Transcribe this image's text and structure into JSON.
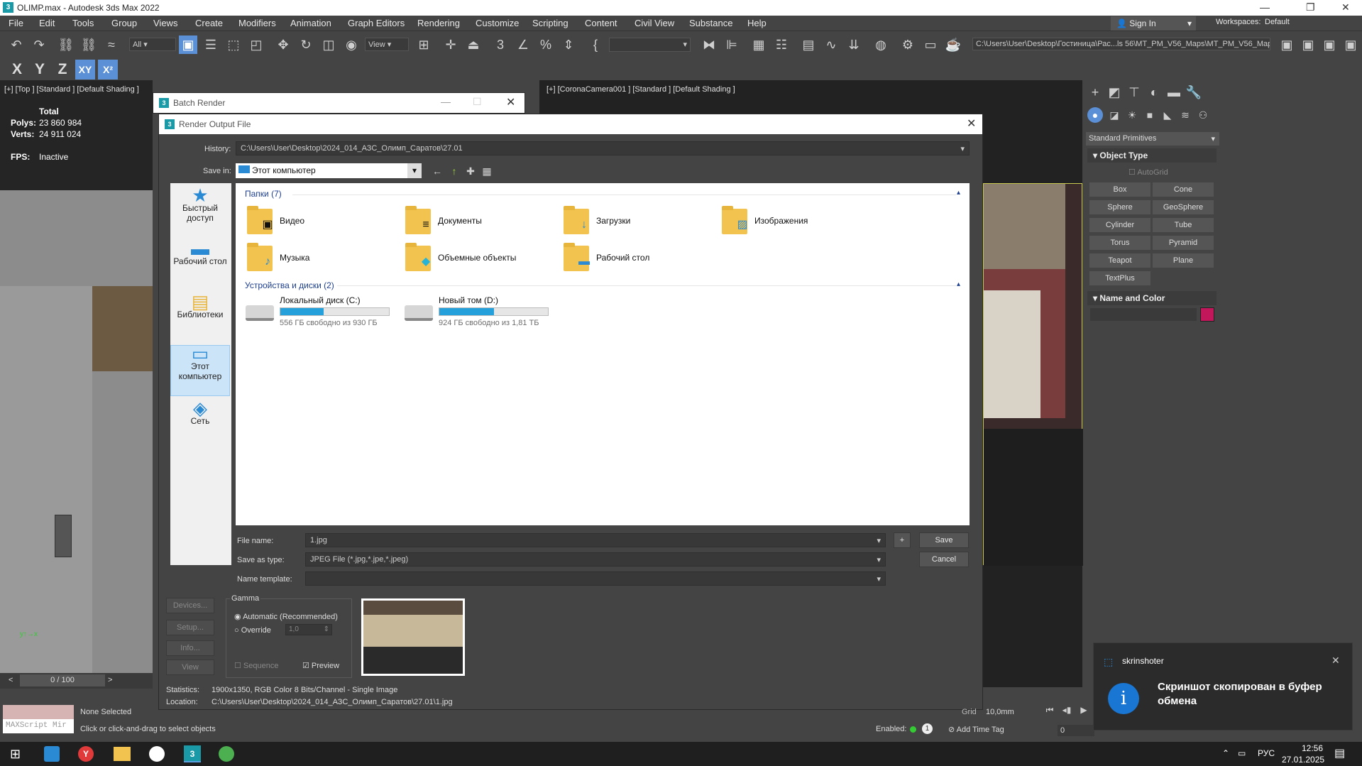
{
  "window": {
    "title": "OLIMP.max - Autodesk 3ds Max 2022",
    "app_icon": "3"
  },
  "menu": [
    "File",
    "Edit",
    "Tools",
    "Group",
    "Views",
    "Create",
    "Modifiers",
    "Animation",
    "Graph Editors",
    "Rendering",
    "Customize",
    "Scripting",
    "Content",
    "Civil View",
    "Substance",
    "Help"
  ],
  "signin": {
    "label": "Sign In",
    "workspaces_label": "Workspaces:",
    "workspace_value": "Default"
  },
  "toolbar": {
    "selection_filter": "All",
    "ref_coord": "View",
    "project_path": "C:\\Users\\User\\Desktop\\Гостиница\\Рас...ls 56\\MT_PM_V56_Maps\\MT_PM_V56_Maps"
  },
  "axis_buttons": [
    "X",
    "Y",
    "Z",
    "XY",
    "X²"
  ],
  "viewport_left": {
    "label": "[+] [Top ] [Standard ] [Default Shading ]"
  },
  "viewport_right": {
    "label": "[+] [CoronaCamera001 ] [Standard ] [Default Shading ]"
  },
  "stats": {
    "header": "Total",
    "polys_label": "Polys:",
    "polys_value": "23 860 984",
    "verts_label": "Verts:",
    "verts_value": "24 911 024",
    "fps_label": "FPS:",
    "fps_value": "Inactive"
  },
  "command_panel": {
    "dropdown": "Standard Primitives",
    "object_type": "Object Type",
    "autogrid": "AutoGrid",
    "buttons": [
      "Box",
      "Cone",
      "Sphere",
      "GeoSphere",
      "Cylinder",
      "Tube",
      "Torus",
      "Pyramid",
      "Teapot",
      "Plane",
      "TextPlus"
    ],
    "name_and_color": "Name and Color",
    "color": "#c2185b"
  },
  "batch_render": {
    "title": "Batch Render"
  },
  "render_output": {
    "title": "Render Output File",
    "history_label": "History:",
    "history_value": "C:\\Users\\User\\Desktop\\2024_014_АЗС_Олимп_Саратов\\27.01",
    "save_in_label": "Save in:",
    "save_in_value": "Этот компьютер",
    "nav": [
      {
        "label": "Быстрый доступ",
        "icon": "star-icon",
        "glyph": "★"
      },
      {
        "label": "Рабочий стол",
        "icon": "desktop-icon",
        "glyph": "▬"
      },
      {
        "label": "Библиотеки",
        "icon": "libraries-icon",
        "glyph": "▤"
      },
      {
        "label": "Этот компьютер",
        "icon": "computer-icon",
        "glyph": "▭"
      },
      {
        "label": "Сеть",
        "icon": "network-icon",
        "glyph": "◈"
      }
    ],
    "folders_header": "Папки (7)",
    "folders": [
      {
        "name": "Видео",
        "icon": "video-folder-icon",
        "glyph": "▣"
      },
      {
        "name": "Документы",
        "icon": "documents-folder-icon",
        "glyph": "≡"
      },
      {
        "name": "Загрузки",
        "icon": "downloads-folder-icon",
        "glyph": "↓"
      },
      {
        "name": "Изображения",
        "icon": "pictures-folder-icon",
        "glyph": "▨"
      },
      {
        "name": "Музыка",
        "icon": "music-folder-icon",
        "glyph": "♪"
      },
      {
        "name": "Объемные объекты",
        "icon": "3d-objects-folder-icon",
        "glyph": "◆"
      },
      {
        "name": "Рабочий стол",
        "icon": "desktop-folder-icon",
        "glyph": "▬"
      }
    ],
    "drives_header": "Устройства и диски (2)",
    "drives": [
      {
        "name": "Локальный диск (C:)",
        "free": "556 ГБ свободно из 930 ГБ",
        "used_fraction": 0.4
      },
      {
        "name": "Новый том (D:)",
        "free": "924 ГБ свободно из 1,81 ТБ",
        "used_fraction": 0.5
      }
    ],
    "file_name_label": "File name:",
    "file_name_value": "1.jpg",
    "save_type_label": "Save as type:",
    "save_type_value": "JPEG File (*.jpg,*.jpe,*.jpeg)",
    "name_template_label": "Name template:",
    "save_button": "Save",
    "cancel_button": "Cancel",
    "plus_button": "+",
    "devices_button": "Devices...",
    "setup_button": "Setup...",
    "info_button": "Info...",
    "view_button": "View",
    "gamma_label": "Gamma",
    "gamma_auto": "Automatic (Recommended)",
    "gamma_override": "Override",
    "gamma_value": "1,0",
    "sequence_label": "Sequence",
    "preview_label": "Preview",
    "statistics_label": "Statistics:",
    "statistics_value": "1900x1350, RGB Color 8 Bits/Channel - Single Image",
    "location_label": "Location:",
    "location_value": "C:\\Users\\User\\Desktop\\2024_014_АЗС_Олимп_Саратов\\27.01\\1.jpg"
  },
  "timeline": {
    "frame": "0 / 100"
  },
  "status": {
    "selection": "None Selected",
    "prompt": "Click or click-and-drag to select objects",
    "maxscript": "MAXScript Mir",
    "enabled_label": "Enabled:",
    "add_time_tag": "Add Time Tag",
    "grid": "10,0mm",
    "grid_prefix": "Grid",
    "frame_field": "0"
  },
  "toast": {
    "app": "skrinshoter",
    "message": "Скриншот скопирован в буфер обмена"
  },
  "taskbar": {
    "lang": "РУС",
    "time": "12:56",
    "date": "27.01.2025"
  }
}
